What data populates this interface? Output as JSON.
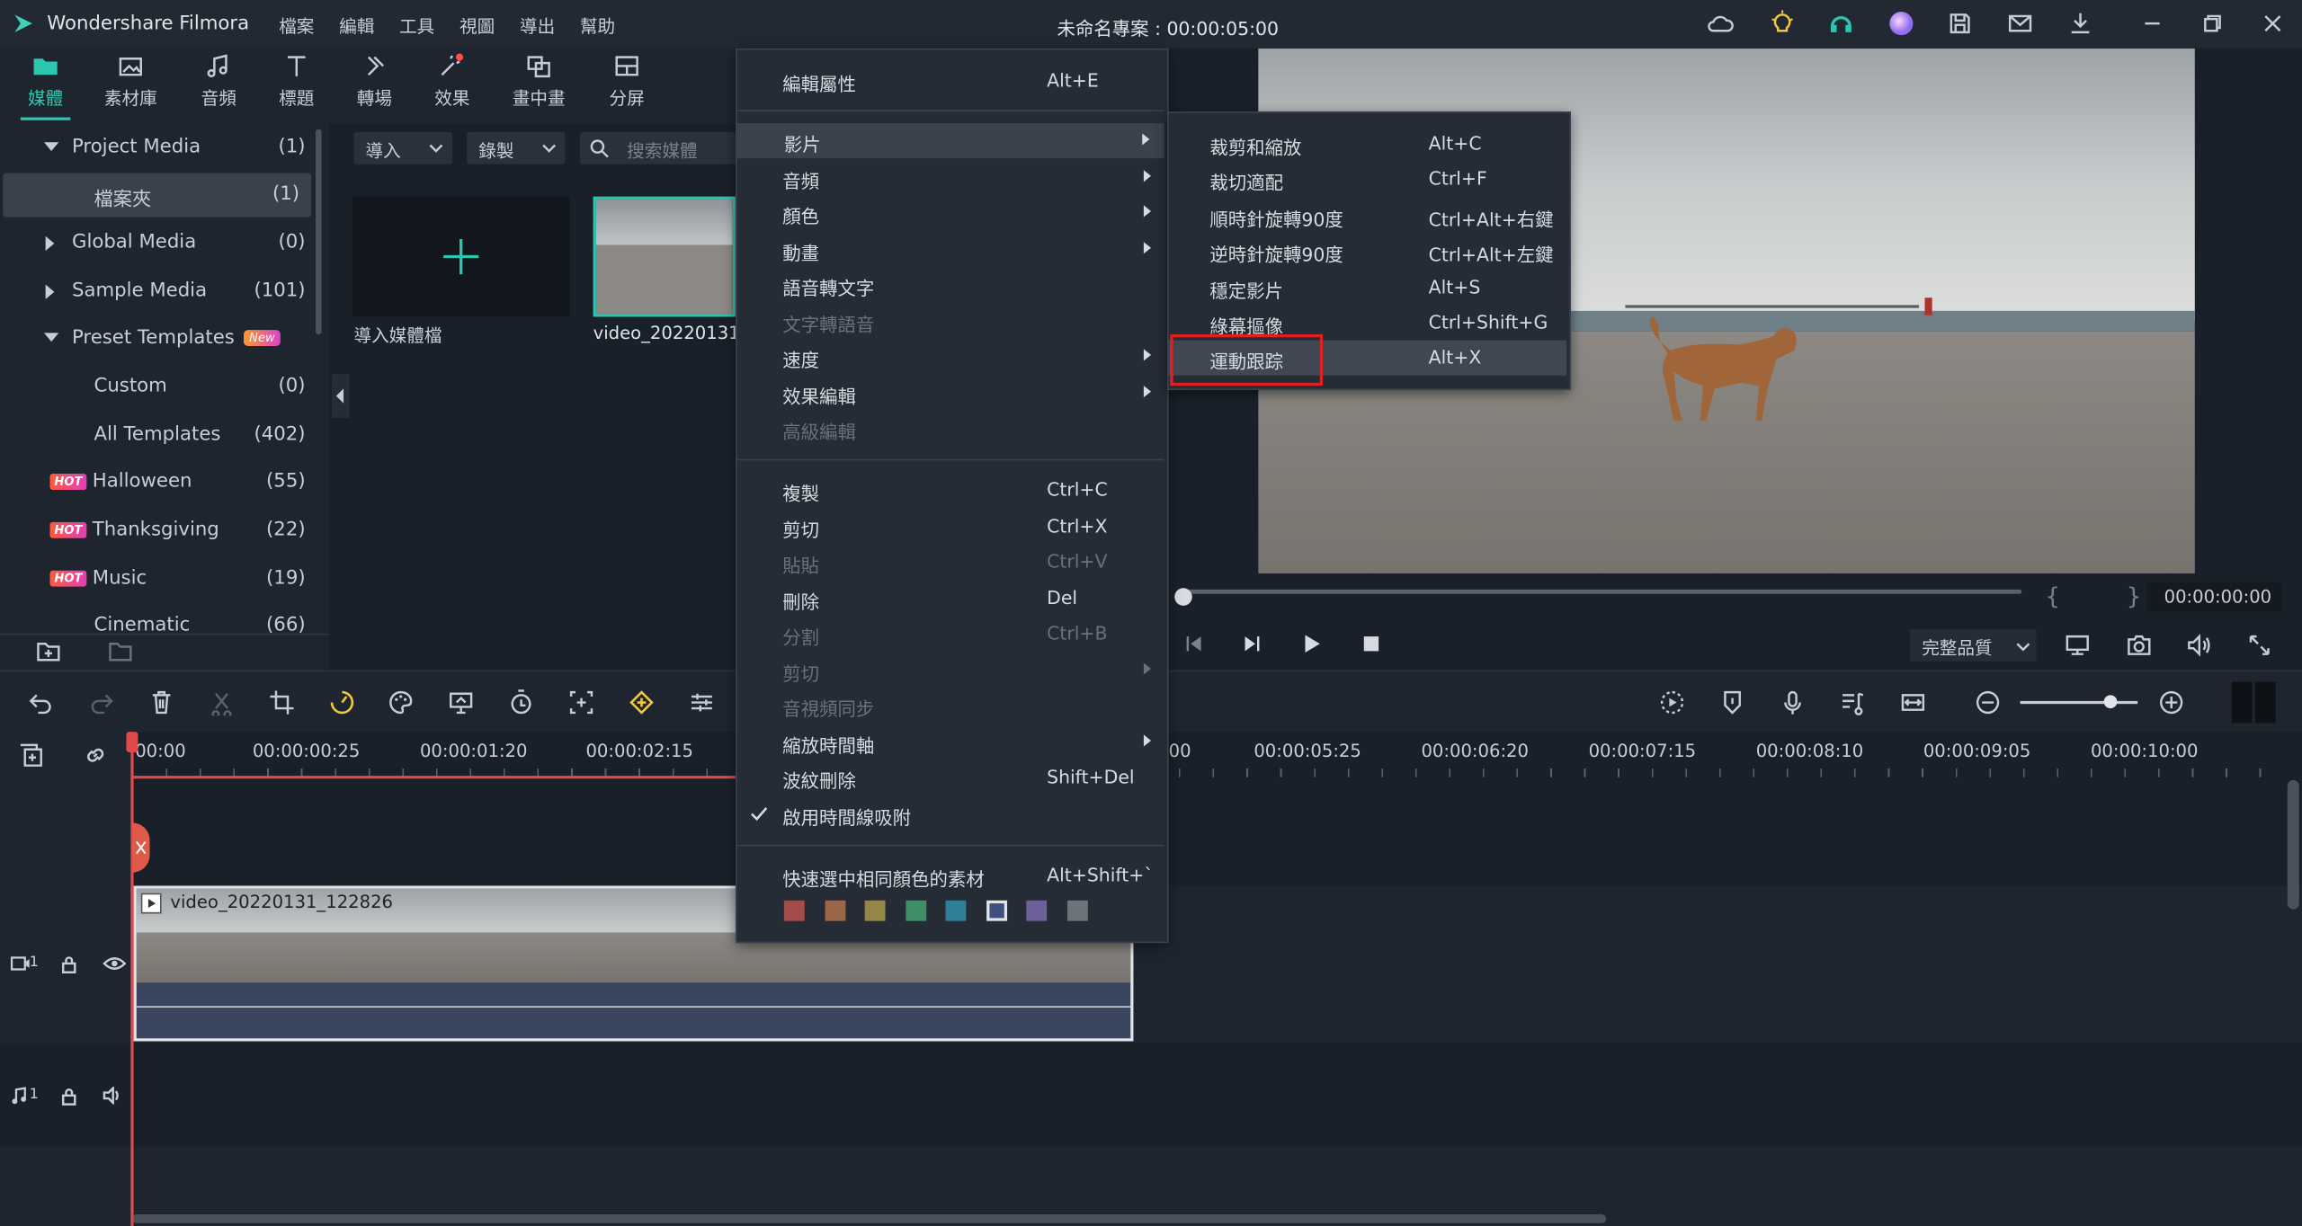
{
  "app": {
    "name": "Wondershare Filmora",
    "menu": [
      "檔案",
      "編輯",
      "工具",
      "視圖",
      "導出",
      "幫助"
    ],
    "project_title": "未命名專案 : 00:00:05:00"
  },
  "toolbar_tabs": [
    "媒體",
    "素材庫",
    "音頻",
    "標題",
    "轉場",
    "效果",
    "畫中畫",
    "分屏"
  ],
  "media_tree": [
    {
      "label": "Project Media",
      "count": "(1)"
    },
    {
      "label": "檔案夾",
      "count": "(1)"
    },
    {
      "label": "Global Media",
      "count": "(0)"
    },
    {
      "label": "Sample Media",
      "count": "(101)"
    },
    {
      "label": "Preset Templates",
      "count": "",
      "badge": "New"
    },
    {
      "label": "Custom",
      "count": "(0)"
    },
    {
      "label": "All Templates",
      "count": "(402)"
    },
    {
      "label": "Halloween",
      "count": "(55)",
      "badge": "HOT"
    },
    {
      "label": "Thanksgiving",
      "count": "(22)",
      "badge": "HOT"
    },
    {
      "label": "Music",
      "count": "(19)",
      "badge": "HOT"
    },
    {
      "label": "Cinematic",
      "count": "(66)"
    }
  ],
  "media_panel": {
    "import_label": "導入",
    "record_label": "錄製",
    "search_placeholder": "搜索媒體",
    "import_tile_label": "導入媒體檔",
    "clip_tile_label": "video_20220131_"
  },
  "context_menu": {
    "items": [
      {
        "label": "編輯屬性",
        "key": "Alt+E"
      },
      {
        "label": "影片",
        "key": ""
      },
      {
        "label": "音頻",
        "key": ""
      },
      {
        "label": "顏色",
        "key": ""
      },
      {
        "label": "動畫",
        "key": ""
      },
      {
        "label": "語音轉文字",
        "key": ""
      },
      {
        "label": "文字轉語音",
        "key": ""
      },
      {
        "label": "速度",
        "key": ""
      },
      {
        "label": "效果編輯",
        "key": ""
      },
      {
        "label": "高級編輯",
        "key": ""
      },
      {
        "label": "複製",
        "key": "Ctrl+C"
      },
      {
        "label": "剪切",
        "key": "Ctrl+X"
      },
      {
        "label": "貼貼",
        "key": "Ctrl+V"
      },
      {
        "label": "刪除",
        "key": "Del"
      },
      {
        "label": "分割",
        "key": "Ctrl+B"
      },
      {
        "label": "剪切",
        "key": ""
      },
      {
        "label": "音視頻同步",
        "key": ""
      },
      {
        "label": "縮放時間軸",
        "key": ""
      },
      {
        "label": "波紋刪除",
        "key": "Shift+Del"
      },
      {
        "label": "啟用時間線吸附",
        "key": ""
      },
      {
        "label": "快速選中相同顏色的素材",
        "key": "Alt+Shift+`"
      }
    ],
    "swatch_colors": [
      "#a44b4b",
      "#9a6648",
      "#948648",
      "#3f8f66",
      "#2f7f98",
      "#3f4f7f",
      "#6d5f98",
      "#6e737a"
    ]
  },
  "submenu": {
    "items": [
      {
        "label": "裁剪和縮放",
        "key": "Alt+C"
      },
      {
        "label": "裁切適配",
        "key": "Ctrl+F"
      },
      {
        "label": "順時針旋轉90度",
        "key": "Ctrl+Alt+右鍵"
      },
      {
        "label": "逆時針旋轉90度",
        "key": "Ctrl+Alt+左鍵"
      },
      {
        "label": "穩定影片",
        "key": "Alt+S"
      },
      {
        "label": "綠幕摳像",
        "key": "Ctrl+Shift+G"
      },
      {
        "label": "運動跟踪",
        "key": "Alt+X"
      }
    ]
  },
  "preview": {
    "timecode": "00:00:00:00",
    "quality": "完整品質",
    "brackets": "{ }"
  },
  "timeline": {
    "ticks_left": [
      "00:00",
      "00:00:00:25",
      "00:00:01:20",
      "00:00:02:15"
    ],
    "ticks_right": [
      "00",
      "00:00:05:25",
      "00:00:06:20",
      "00:00:07:15",
      "00:00:08:10",
      "00:00:09:05",
      "00:00:10:00"
    ],
    "clip_name": "video_20220131_122826",
    "video_track": "1",
    "audio_track": "1"
  },
  "accent_color": "#2cc7b0",
  "highlight_color": "#e02020"
}
